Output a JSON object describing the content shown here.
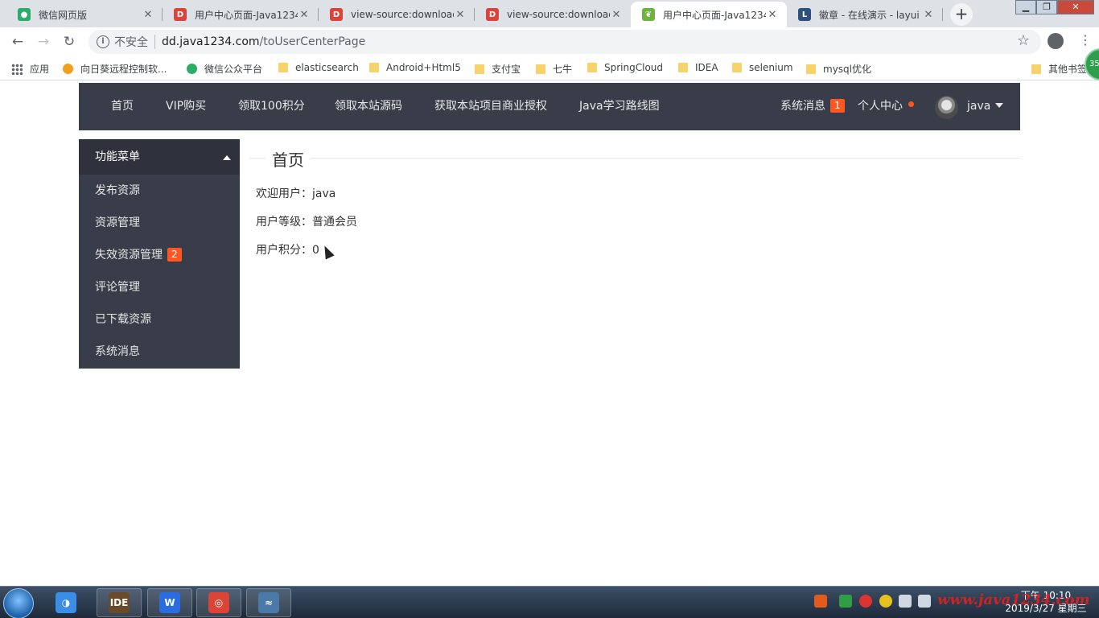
{
  "browser": {
    "tabs": [
      {
        "title": "微信网页版",
        "color": "#2aae67",
        "glyph": "●"
      },
      {
        "title": "用户中心页面-Java1234",
        "color": "#d9453c",
        "glyph": "D"
      },
      {
        "title": "view-source:download",
        "color": "#d9453c",
        "glyph": "D"
      },
      {
        "title": "view-source:download",
        "color": "#d9453c",
        "glyph": "D"
      },
      {
        "title": "用户中心页面-Java1234",
        "color": "#6db33f",
        "glyph": "❦"
      },
      {
        "title": "徽章 - 在线演示 - layui",
        "color": "#2f4f7f",
        "glyph": "L"
      }
    ],
    "active_tab": 4,
    "security_label": "不安全",
    "url_host": "dd.java1234.com",
    "url_path": "/toUserCenterPage",
    "bookmarks": [
      {
        "label": "应用",
        "kind": "apps"
      },
      {
        "label": "向日葵远程控制软...",
        "kind": "dot",
        "color": "#f0a020"
      },
      {
        "label": "微信公众平台",
        "kind": "dot",
        "color": "#2aae67"
      },
      {
        "label": "elasticsearch",
        "kind": "folder"
      },
      {
        "label": "Android+Html5",
        "kind": "folder"
      },
      {
        "label": "支付宝",
        "kind": "folder"
      },
      {
        "label": "七牛",
        "kind": "folder"
      },
      {
        "label": "SpringCloud",
        "kind": "folder"
      },
      {
        "label": "IDEA",
        "kind": "folder"
      },
      {
        "label": "selenium",
        "kind": "folder"
      },
      {
        "label": "mysql优化",
        "kind": "folder"
      },
      {
        "label": "其他书签",
        "kind": "folder"
      }
    ],
    "extension_badge": "35"
  },
  "site": {
    "nav": [
      "首页",
      "VIP购买",
      "领取100积分",
      "领取本站源码",
      "获取本站项目商业授权",
      "Java学习路线图"
    ],
    "messages_label": "系统消息",
    "messages_badge": "1",
    "user_center_label": "个人中心",
    "username": "java"
  },
  "sidebar": {
    "title": "功能菜单",
    "items": [
      {
        "label": "发布资源"
      },
      {
        "label": "资源管理"
      },
      {
        "label": "失效资源管理",
        "badge": "2"
      },
      {
        "label": "评论管理"
      },
      {
        "label": "已下载资源"
      },
      {
        "label": "系统消息"
      }
    ]
  },
  "main": {
    "title": "首页",
    "lines": [
      "欢迎用户：java",
      "用户等级：普通会员",
      "用户积分：0"
    ]
  },
  "taskbar": {
    "apps": [
      {
        "name": "qq-pinyin",
        "color": "#3a8ee6",
        "glyph": "◑"
      },
      {
        "name": "javaee-ide",
        "color": "#6b4a2a",
        "glyph": "IDE"
      },
      {
        "name": "wps",
        "color": "#2b6de0",
        "glyph": "W"
      },
      {
        "name": "chrome",
        "color": "#db4437",
        "glyph": "◎"
      },
      {
        "name": "mysql-dolphin",
        "color": "#4a7aa8",
        "glyph": "≈"
      }
    ],
    "clock_time": "下午 10:10",
    "clock_date": "2019/3/27 星期三",
    "watermark": "www.java1234.com"
  }
}
